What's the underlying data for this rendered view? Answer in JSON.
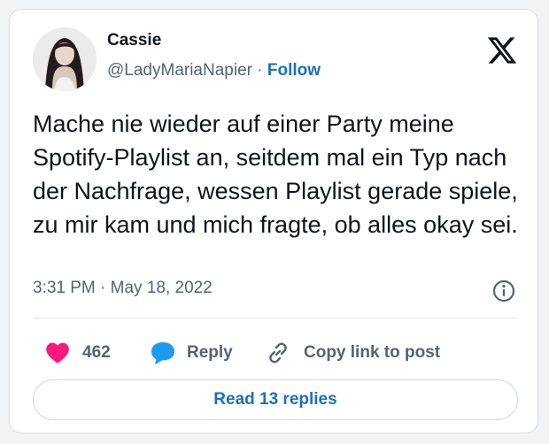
{
  "author": {
    "name": "Cassie",
    "handle": "@LadyMariaNapier",
    "separator": "·",
    "follow_label": "Follow"
  },
  "tweet": {
    "text": "Mache nie wieder auf einer Party meine Spotify-Playlist an, seitdem mal ein Typ nach der Nachfrage, wessen Playlist gerade spiele, zu mir kam und mich fragte, ob alles okay sei.",
    "timestamp": "3:31 PM · May 18, 2022"
  },
  "actions": {
    "like_count": "462",
    "reply_label": "Reply",
    "copy_label": "Copy link to post"
  },
  "read_replies_label": "Read 13 replies",
  "icons": {
    "logo": "x-logo-icon",
    "info": "info-icon",
    "like": "heart-icon",
    "reply": "speech-bubble-icon",
    "copy": "link-icon"
  },
  "colors": {
    "link_blue": "#1d70b8",
    "heart": "#f91880",
    "reply_bubble": "#1d9bf0",
    "muted": "#536471"
  }
}
